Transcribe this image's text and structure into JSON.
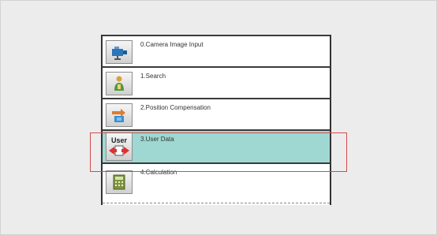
{
  "flow": {
    "items": [
      {
        "label": "0.Camera Image Input",
        "icon": "camera-icon"
      },
      {
        "label": "1.Search",
        "icon": "search-person-icon"
      },
      {
        "label": "2.Position Compensation",
        "icon": "position-compensation-icon"
      },
      {
        "label": "3.User Data",
        "icon": "user-data-icon",
        "icon_text": "User",
        "selected": true
      },
      {
        "label": "4.Calculation",
        "icon": "calculator-icon"
      }
    ]
  },
  "colors": {
    "selected_row": "#9fd8d2",
    "highlight_border": "#d64a4a",
    "row_border": "#3a3a3a"
  }
}
